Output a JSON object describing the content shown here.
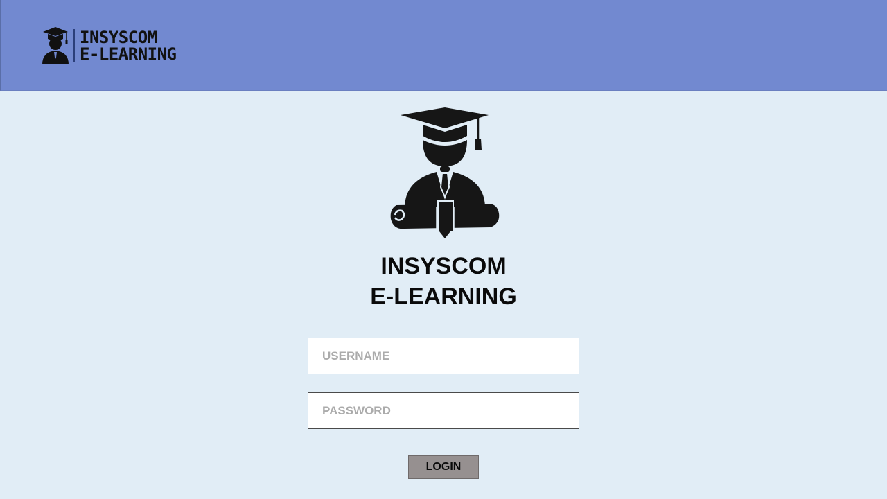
{
  "header": {
    "logo_icon": "graduate-icon",
    "logo_line1": "INSYSCOM",
    "logo_line2": "E-LEARNING",
    "background_color": "#7289d0"
  },
  "main": {
    "hero_icon": "graduate-with-diploma-icon",
    "title_line1": "INSYSCOM",
    "title_line2": "E-LEARNING",
    "background_color": "#e1edf6"
  },
  "form": {
    "username_placeholder": "USERNAME",
    "username_value": "",
    "password_placeholder": "PASSWORD",
    "password_value": "",
    "login_label": "LOGIN",
    "login_color": "#969090"
  }
}
